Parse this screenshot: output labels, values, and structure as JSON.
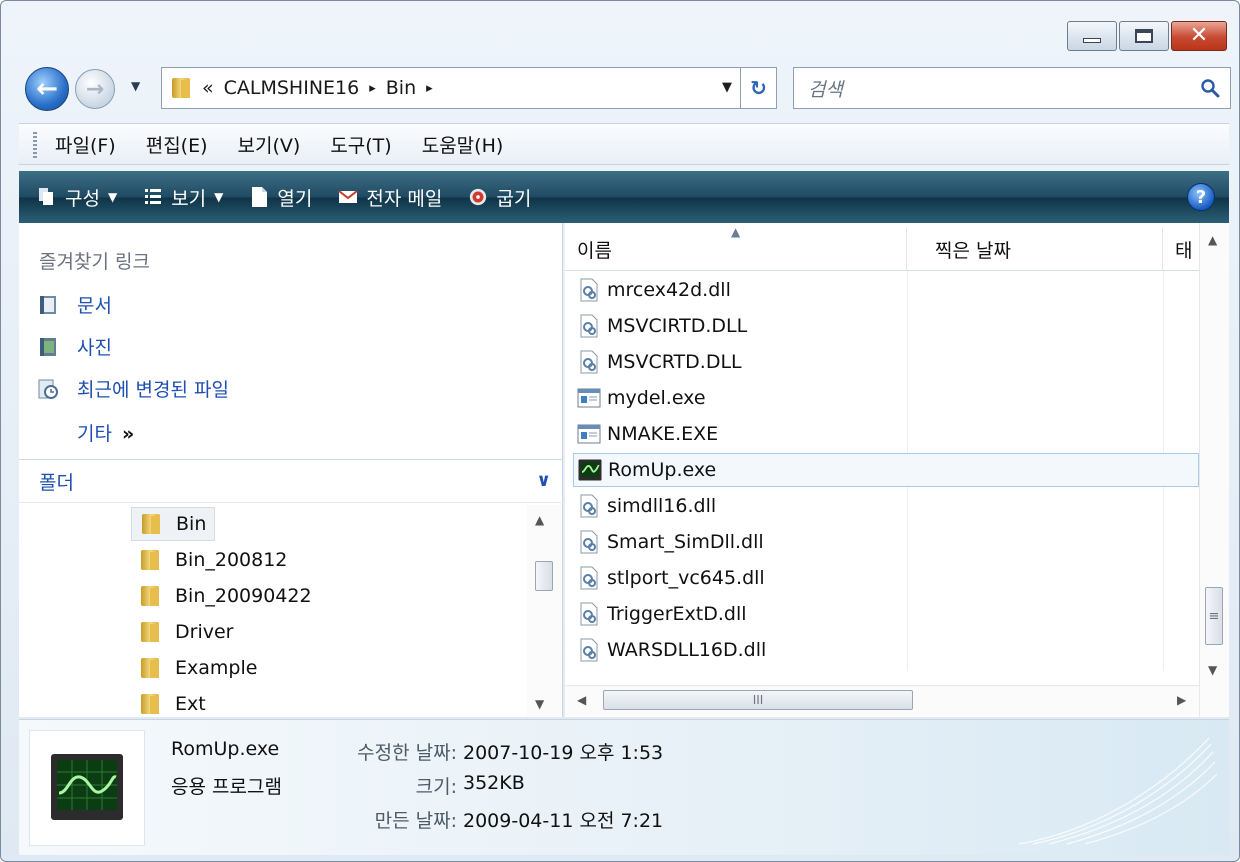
{
  "address": {
    "breadcrumb_prefix": "«",
    "crumbs": [
      "CALMSHINE16",
      "Bin"
    ],
    "separator": "▸"
  },
  "search": {
    "placeholder": "검색"
  },
  "menu": [
    "파일(F)",
    "편집(E)",
    "보기(V)",
    "도구(T)",
    "도움말(H)"
  ],
  "commands": {
    "organize": "구성",
    "view": "보기",
    "open": "열기",
    "email": "전자 메일",
    "burn": "굽기",
    "help": "?"
  },
  "favorites": {
    "heading": "즐겨찾기 링크",
    "items": [
      "문서",
      "사진",
      "최근에 변경된 파일"
    ],
    "more": "기타",
    "more_arrows": "»"
  },
  "folders": {
    "heading": "폴더",
    "items": [
      "Bin",
      "Bin_200812",
      "Bin_20090422",
      "Driver",
      "Example",
      "Ext"
    ],
    "selected": "Bin"
  },
  "columns": {
    "name": "이름",
    "date_taken": "찍은 날짜",
    "tags": "태"
  },
  "files": [
    {
      "name": "mrcex42d.dll",
      "type": "dll"
    },
    {
      "name": "MSVCIRTD.DLL",
      "type": "dll"
    },
    {
      "name": "MSVCRTD.DLL",
      "type": "dll"
    },
    {
      "name": "mydel.exe",
      "type": "exe"
    },
    {
      "name": "NMAKE.EXE",
      "type": "exe"
    },
    {
      "name": "RomUp.exe",
      "type": "app",
      "selected": true
    },
    {
      "name": "simdll16.dll",
      "type": "dll"
    },
    {
      "name": "Smart_SimDll.dll",
      "type": "dll"
    },
    {
      "name": "stlport_vc645.dll",
      "type": "dll"
    },
    {
      "name": "TriggerExtD.dll",
      "type": "dll"
    },
    {
      "name": "WARSDLL16D.dll",
      "type": "dll"
    }
  ],
  "hscroll_grip": "III",
  "vscroll_grip": "≡",
  "details": {
    "name": "RomUp.exe",
    "type": "응용 프로그램",
    "modified_label": "수정한 날짜:",
    "modified_value": "2007-10-19 오후 1:53",
    "size_label": "크기:",
    "size_value": "352KB",
    "created_label": "만든 날짜:",
    "created_value": "2009-04-11 오전 7:21"
  },
  "colors": {
    "accent": "#1f4fb1",
    "command_bar": "#1f4a62",
    "selection_border": "#a7cbe8"
  }
}
